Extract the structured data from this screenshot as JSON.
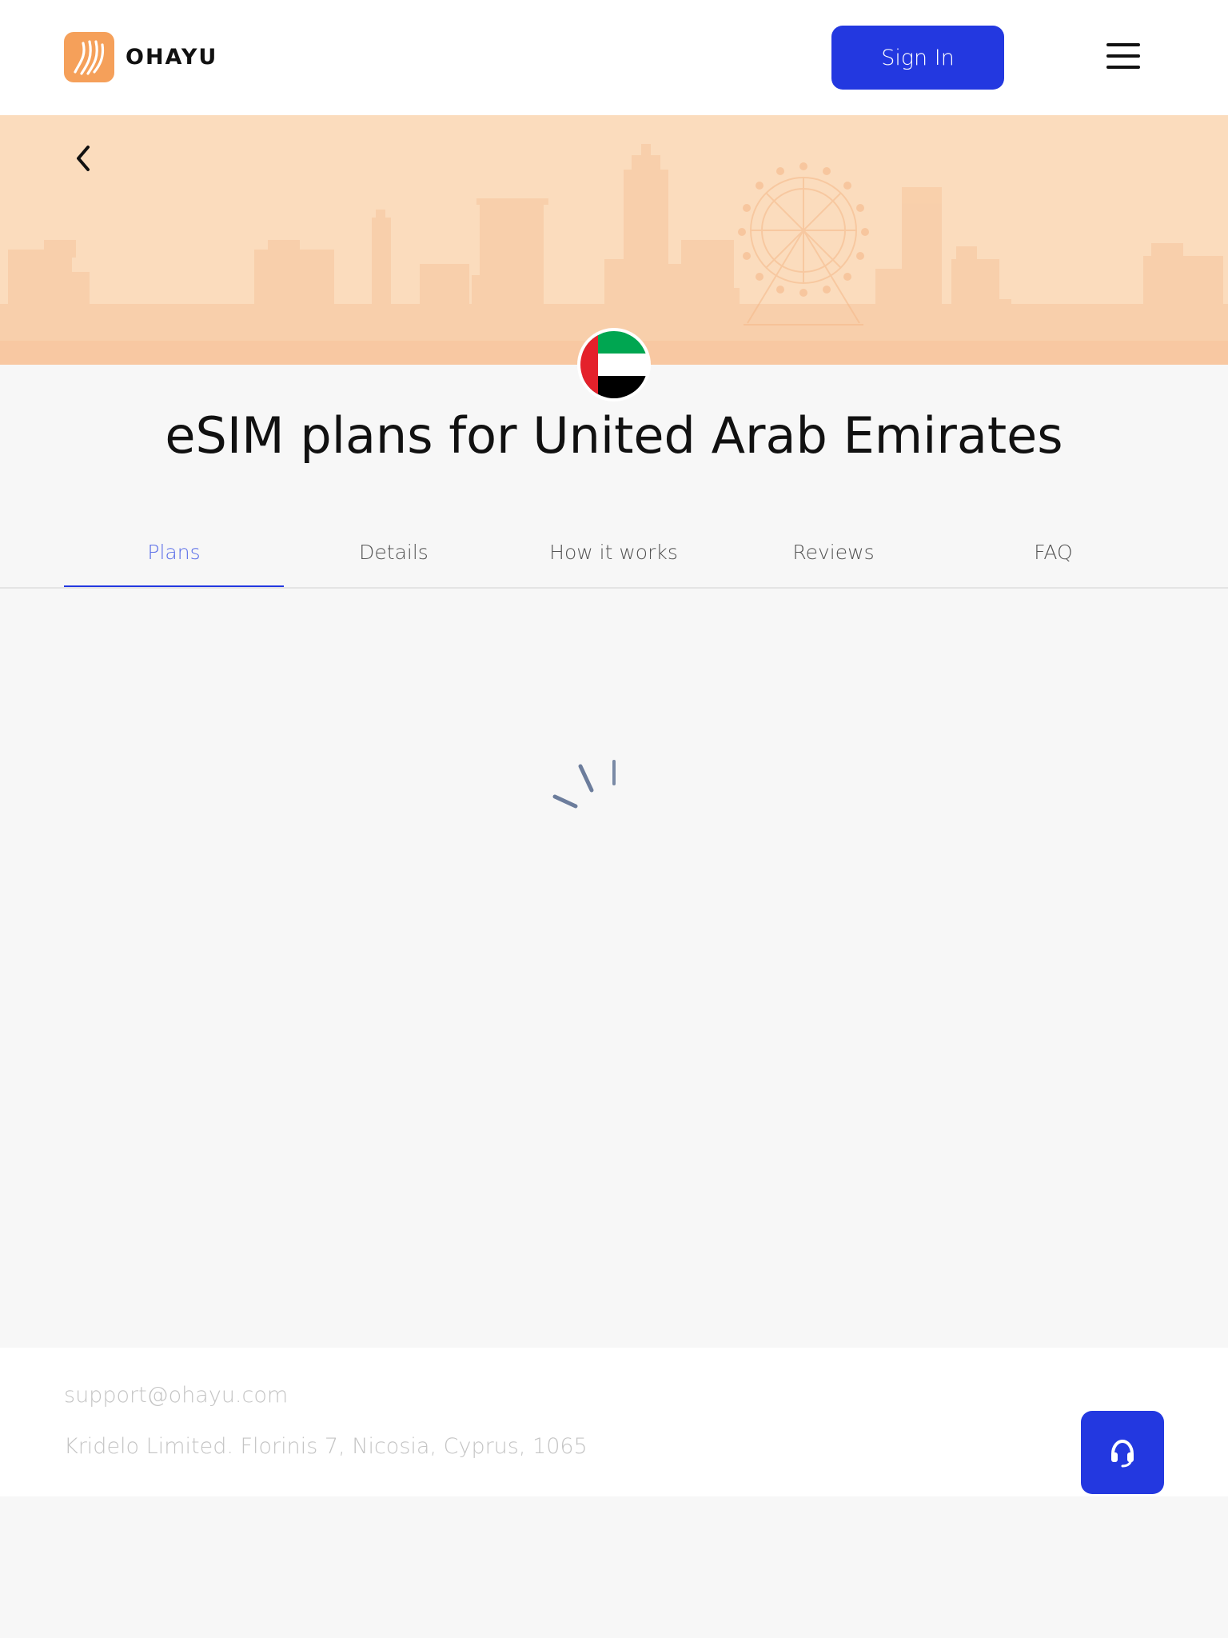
{
  "header": {
    "logo_text": "OHAYU",
    "sign_in_label": "Sign In",
    "brand_color": "#2338e0",
    "logo_color": "#f5a05a"
  },
  "hero": {
    "background_color": "#fbdcbd",
    "country": "United Arab Emirates",
    "title": "eSIM plans for United Arab Emirates"
  },
  "tabs": [
    {
      "label": "Plans",
      "active": true
    },
    {
      "label": "Details",
      "active": false
    },
    {
      "label": "How it works",
      "active": false
    },
    {
      "label": "Reviews",
      "active": false
    },
    {
      "label": "FAQ",
      "active": false
    }
  ],
  "main": {
    "loading": true
  },
  "footer": {
    "email": "support@ohayu.com",
    "address": "Kridelo Limited. Florinis 7, Nicosia, Cyprus, 1065"
  },
  "icons": {
    "back": "chevron-left-icon",
    "menu": "hamburger-icon",
    "support": "headset-icon"
  }
}
